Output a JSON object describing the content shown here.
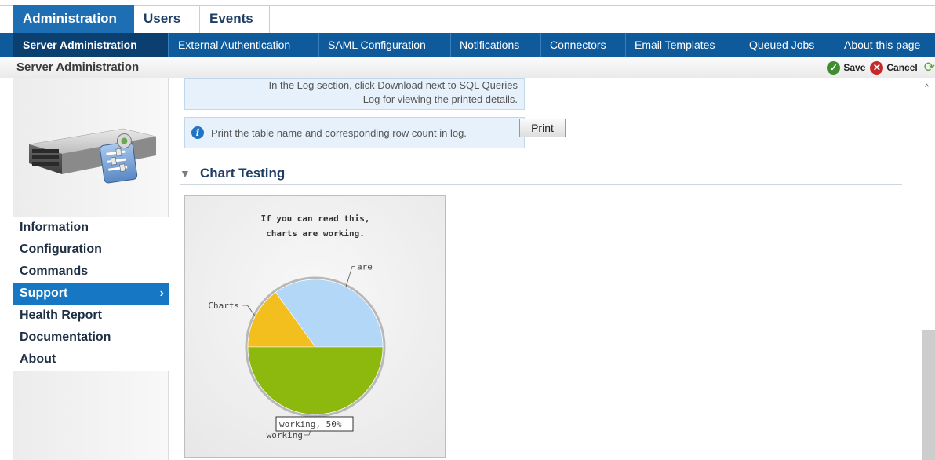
{
  "top_tabs": [
    {
      "label": "Administration",
      "active": true
    },
    {
      "label": "Users",
      "active": false
    },
    {
      "label": "Events",
      "active": false
    }
  ],
  "sub_tabs": [
    {
      "label": "Server Administration",
      "active": true
    },
    {
      "label": "External Authentication",
      "active": false
    },
    {
      "label": "SAML Configuration",
      "active": false
    },
    {
      "label": "Notifications",
      "active": false
    },
    {
      "label": "Connectors",
      "active": false
    },
    {
      "label": "Email Templates",
      "active": false
    },
    {
      "label": "Queued Jobs",
      "active": false
    },
    {
      "label": "About this page",
      "active": false
    }
  ],
  "page_header": {
    "title": "Server Administration",
    "save_label": "Save",
    "cancel_label": "Cancel"
  },
  "sidebar": {
    "items": [
      {
        "label": "Information",
        "active": false
      },
      {
        "label": "Configuration",
        "active": false
      },
      {
        "label": "Commands",
        "active": false
      },
      {
        "label": "Support",
        "active": true
      },
      {
        "label": "Health Report",
        "active": false
      },
      {
        "label": "Documentation",
        "active": false
      },
      {
        "label": "About",
        "active": false
      }
    ]
  },
  "content": {
    "log_info_line1": "In the Log section, click Download next to SQL Queries",
    "log_info_line2": "Log for viewing the printed details.",
    "print_info": "Print the table name and corresponding row count in log.",
    "print_button": "Print",
    "section_title": "Chart Testing"
  },
  "chart_data": {
    "type": "pie",
    "title_line1": "If you can read this,",
    "title_line2": "charts are working.",
    "slices": [
      {
        "label": "Charts",
        "value": 15,
        "color": "#f3bf1f"
      },
      {
        "label": "are",
        "value": 35,
        "color": "#b3d7f7"
      },
      {
        "label": "working",
        "value": 50,
        "color": "#8db80d"
      }
    ],
    "tooltip": "working, 50%"
  },
  "colors": {
    "brand_blue": "#1e6eb3",
    "subnav_blue": "#0f5a9b",
    "sidebar_active": "#1678c4"
  }
}
